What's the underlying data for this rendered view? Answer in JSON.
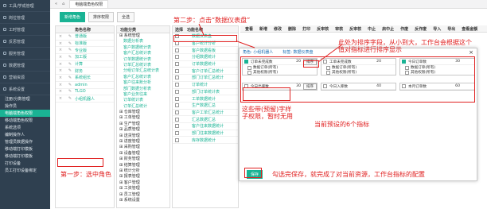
{
  "sidebar": {
    "menus": [
      "工具/学成管理",
      "岗位管理",
      "工时管理",
      "反思管理",
      "服务管理",
      "数据管理",
      "营销资源",
      "系统设置"
    ],
    "subs": [
      "注册/分数管理",
      "操作员",
      "电脑端角色权限",
      "移动端角色权限",
      "系统选项",
      "编制操作人",
      "管理员数据操作",
      "移动端打印模板",
      "移动端打印模板",
      "打印设备",
      "员工打印设备绑定"
    ],
    "active_index": 2
  },
  "tabbar": {
    "tabs": [
      "电脑端角色权限"
    ]
  },
  "toolbar": {
    "add": "新增角色",
    "sort": "排序权限",
    "refresh": "全选"
  },
  "roles": {
    "headers": [
      "",
      "",
      "角色名称"
    ],
    "names": [
      "普通版",
      "标准版",
      "专业版",
      "加工版",
      "计算",
      "财务",
      "系统组长",
      "admin",
      "TLGO",
      "小组机器人"
    ]
  },
  "tree": {
    "header": "功能分类",
    "items": [
      "系统管理",
      "数据分析表",
      "客户数据统计表",
      "客户汇总统计表",
      "订单数据统计表",
      "订单汇总统计表",
      "分组订单汇总统计表",
      "客户汇总统计表",
      "客户往来账分析",
      "部门数据分析表",
      "客户业务往来",
      "订单统计表",
      "订单汇总统计",
      "仓库管理",
      "工单管理",
      "生产管理",
      "品质管理",
      "送货管理",
      "进度管理",
      "采购管理",
      "设备管理",
      "财务管理",
      "结算管理",
      "统计分析",
      "报表管理",
      "客户管理",
      "工资管理",
      "员工管理",
      "系统设置"
    ]
  },
  "funcs": {
    "headers": [
      "选择",
      "功能名称"
    ],
    "items": [
      "数据仪表盘",
      "客户统计分析",
      "客户数据看板",
      "分组数据统计",
      "订单数据统计",
      "客户订单汇总统计",
      "部门订单汇总统计",
      "订单统计",
      "部门订单统计表",
      "工单数据统计",
      "生产数据汇总",
      "客户工单汇总统计",
      "汇总数据汇总",
      "客户往来数据统计",
      "部门往来数据统计",
      "库存数据统计"
    ]
  },
  "perm_headers": [
    "查看",
    "新增",
    "修改",
    "删除",
    "打印",
    "反审核",
    "审核",
    "反审核",
    "中止",
    "启中止",
    "作废",
    "反作废",
    "导入",
    "导出",
    "查看金额"
  ],
  "modal": {
    "role_label": "角色: 小组机器人",
    "func_label": "标签: 数据仪表盘",
    "items": [
      {
        "name": "订单未完成数",
        "value": "20",
        "checked": true
      },
      {
        "name": "工单未完成数",
        "value": "20",
        "checked": false
      },
      {
        "name": "今日订单数",
        "value": "30",
        "checked": true
      },
      {
        "name": "今日出库数",
        "value": "30",
        "checked": false
      },
      {
        "name": "今日入库数",
        "value": "40",
        "checked": false
      },
      {
        "name": "本月订单数",
        "value": "60",
        "checked": false
      }
    ],
    "sub_options": [
      "数据订单(所有)",
      "其他权限(所有)"
    ],
    "sort_btn": "排序",
    "save": "保存"
  },
  "annotations": {
    "step1": "第一步：选中角色",
    "step2": "第二步：点击“数据仪表盘”",
    "sort_note": "此处为排序字段，从小到大，工作台会根据这个值对指标进行排序显示",
    "sub_note": "这些带(预留)字样子权限，暂时无用",
    "preset_note": "当前预设的6个指标",
    "save_note": "勾选完保存，就完成了对当前资源，工作台指标的配置"
  },
  "colors": {
    "accent": "#1ab394",
    "annotation": "#e02020",
    "sidebar": "#2f4050"
  }
}
